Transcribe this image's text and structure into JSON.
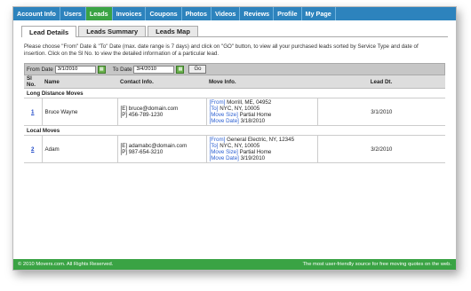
{
  "nav": {
    "tabs": [
      "Account Info",
      "Users",
      "Leads",
      "Invoices",
      "Coupons",
      "Photos",
      "Videos",
      "Reviews",
      "Profile",
      "My Page"
    ],
    "active_index": 2
  },
  "subtabs": {
    "items": [
      "Lead Details",
      "Leads Summary",
      "Leads Map"
    ],
    "active_index": 0
  },
  "instructions": "Please choose \"From\" Date & \"To\" Date (max. date range is 7 days) and click on \"GO\" button, to view all your purchased leads sorted by Service Type and date of insertion. Click on the Sl No. to view the detailed information of a particular lead.",
  "filter": {
    "from_label": "From Date",
    "from_value": "3/1/2010",
    "to_label": "To Date",
    "to_value": "3/4/2010",
    "go_label": "Go"
  },
  "table": {
    "headers": [
      "Sl No.",
      "Name",
      "Contact Info.",
      "Move Info.",
      "Lead Dt."
    ],
    "groups": [
      {
        "title": "Long Distance Moves",
        "rows": [
          {
            "sno": "1",
            "name": "Bruce Wayne",
            "email": "[E] bruce@domain.com",
            "phone": "[P] 456-789-1230",
            "from_label": "[From]",
            "from": "Morrill, ME, 04952",
            "to_label": "[To]",
            "to": "NYC, NY, 10005",
            "size_label": "[Move Size]",
            "size": "Partial Home",
            "date_label": "[Move Date]",
            "date": "3/18/2010",
            "lead_dt": "3/1/2010"
          }
        ]
      },
      {
        "title": "Local Moves",
        "rows": [
          {
            "sno": "2",
            "name": "Adam",
            "email": "[E] adamabc@domain.com",
            "phone": "[P] 987-654-3210",
            "from_label": "[From]",
            "from": "General Electric, NY, 12345",
            "to_label": "[To]",
            "to": "NYC, NY, 10005",
            "size_label": "[Move Size]",
            "size": "Partial Home",
            "date_label": "[Move Date]",
            "date": "3/19/2010",
            "lead_dt": "3/2/2010"
          }
        ]
      }
    ]
  },
  "footer": {
    "left": "© 2010 Movers.com. All Rights Reserved.",
    "right": "The most user-friendly source for free moving quotes on the web."
  },
  "colors": {
    "nav_blue": "#2d83bd",
    "accent_green": "#3aa344",
    "link_blue": "#1a44c6"
  }
}
